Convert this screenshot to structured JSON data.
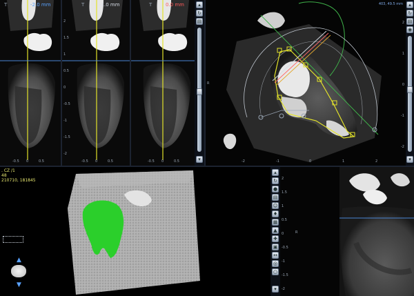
{
  "slices": [
    {
      "label": "T",
      "offset": "-2.0 mm",
      "color": "#5aa2ff"
    },
    {
      "label": "T",
      "offset": "-1.0 mm",
      "color": "#d8dde6"
    },
    {
      "label": "T",
      "offset": "0.0 mm",
      "color": "#ff5a5a"
    }
  ],
  "slice_side_ticks": [
    "2",
    "1.5",
    "1",
    "0.5",
    "0",
    "-0.5",
    "-1",
    "-1.5",
    "-2"
  ],
  "slice_bottom_ticks": [
    "-0.5",
    "0",
    "0.5"
  ],
  "axial_view": {
    "readout": "403, 49.5 mm",
    "bottom_ticks": [
      "-2",
      "-1",
      "0",
      "1",
      "2"
    ],
    "side_ticks": [
      "2",
      "1",
      "0",
      "-1",
      "-2"
    ],
    "axis_label": "R"
  },
  "volume_view": {
    "info_lines": [
      ". CZ /1",
      "48",
      "210710, 181845"
    ],
    "orientation_arrows": [
      "arrow-up",
      "arrow-down"
    ]
  },
  "panoramic_view": {
    "side_ticks": [
      "2",
      "1.5",
      "1",
      "0.5",
      "0",
      "-0.5",
      "-1",
      "-1.5",
      "-2"
    ],
    "axis_label": "R"
  },
  "colors": {
    "cursor_yellow": "#e3e32a",
    "reference_blue": "#4a86d6",
    "nerve_green": "#3fb24a",
    "tooth_model_green": "#2bcf2b"
  }
}
